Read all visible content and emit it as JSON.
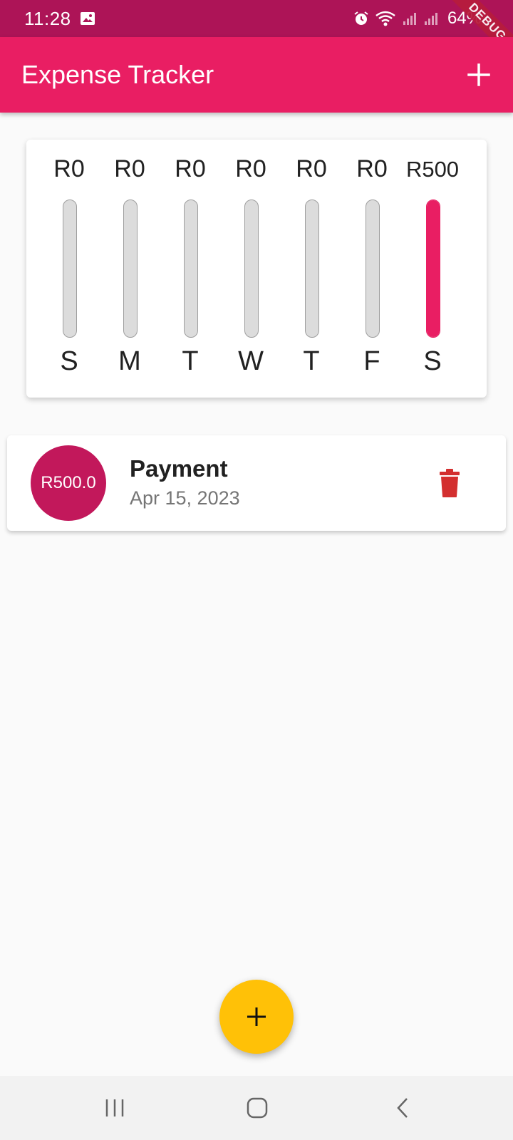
{
  "status_bar": {
    "time": "11:28",
    "battery": "64%",
    "debug_label": "DEBUG"
  },
  "app_bar": {
    "title": "Expense Tracker",
    "add_icon": "plus-icon"
  },
  "chart": {
    "days": [
      {
        "label": "S",
        "amount": "R0",
        "fraction": 0
      },
      {
        "label": "M",
        "amount": "R0",
        "fraction": 0
      },
      {
        "label": "T",
        "amount": "R0",
        "fraction": 0
      },
      {
        "label": "W",
        "amount": "R0",
        "fraction": 0
      },
      {
        "label": "T",
        "amount": "R0",
        "fraction": 0
      },
      {
        "label": "F",
        "amount": "R0",
        "fraction": 0
      },
      {
        "label": "S",
        "amount": "R500",
        "fraction": 1
      }
    ]
  },
  "transactions": [
    {
      "amount": "R500.0",
      "title": "Payment",
      "date": "Apr 15, 2023",
      "delete_icon": "trash-icon"
    }
  ],
  "fab": {
    "icon": "plus-icon"
  },
  "colors": {
    "primary": "#e91e63",
    "status_bar": "#ad1457",
    "accent": "#ffc107",
    "delete": "#d32f2f"
  }
}
